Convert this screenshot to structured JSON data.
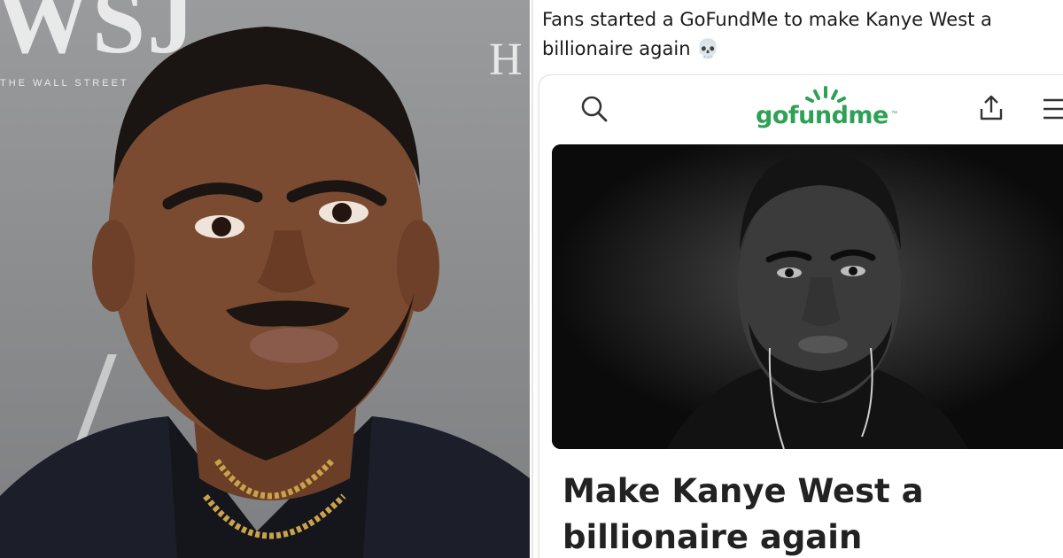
{
  "left_photo": {
    "backdrop_wsj": "WSJ",
    "backdrop_street": "THE WALL STREET",
    "backdrop_h": "H"
  },
  "tweet": {
    "text": "Fans started a GoFundMe to make Kanye West a billionaire again",
    "emoji": "💀"
  },
  "gofundme": {
    "logo_text": "gofundme",
    "trademark": "™",
    "brand_color": "#2fa155",
    "icons": {
      "search": "search-icon",
      "share": "share-icon",
      "menu": "menu-icon"
    },
    "campaign_title": "Make Kanye West a billionaire again"
  }
}
